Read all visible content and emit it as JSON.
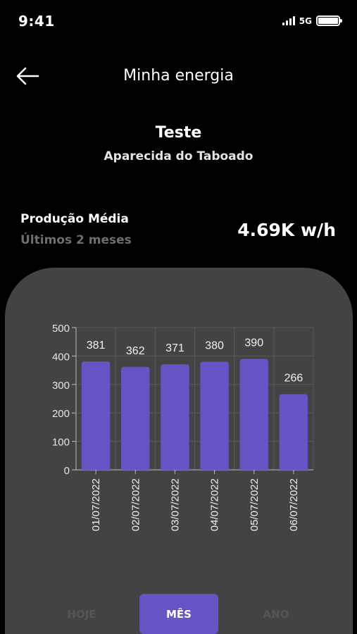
{
  "status_bar": {
    "time": "9:41",
    "network": "5G"
  },
  "header": {
    "title": "Minha energia"
  },
  "site": {
    "name": "Teste",
    "location": "Aparecida do Taboado"
  },
  "production": {
    "label": "Produção Média",
    "period": "Últimos 2 meses",
    "value": "4.69K w/h"
  },
  "colors": {
    "bar": "#6753c4",
    "card": "#434343",
    "accent": "#6753c4"
  },
  "chart_data": {
    "type": "bar",
    "categories": [
      "01/07/2022",
      "02/07/2022",
      "03/07/2022",
      "04/07/2022",
      "05/07/2022",
      "06/07/2022"
    ],
    "values": [
      381,
      362,
      371,
      380,
      390,
      266
    ],
    "ylim": [
      0,
      500
    ],
    "yticks": [
      "0",
      "100",
      "200",
      "300",
      "400",
      "500"
    ],
    "grid": true,
    "title": "",
    "xlabel": "",
    "ylabel": ""
  },
  "tabs": [
    {
      "label": "HOJE",
      "active": false
    },
    {
      "label": "MÊS",
      "active": true
    },
    {
      "label": "ANO",
      "active": false
    }
  ]
}
